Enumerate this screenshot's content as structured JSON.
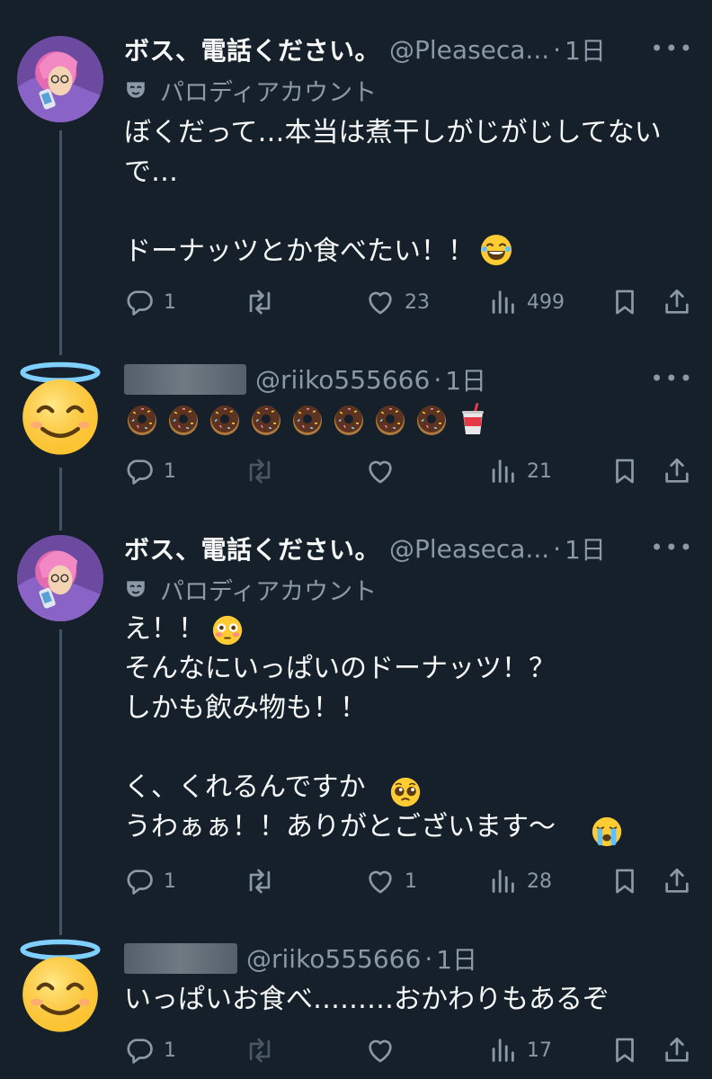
{
  "tweets": [
    {
      "name": "ボス、電話ください。",
      "handle": "@Pleaseca...",
      "time": "1日",
      "parody_label": "パロディアカウント",
      "text": "ぼくだって…本当は煮干しがじがじしてないで…\n\nドーナッツとか食べたい！！",
      "replies": "1",
      "retweets": "",
      "likes": "23",
      "views": "499"
    },
    {
      "name": "",
      "handle": "@riiko555666",
      "time": "1日",
      "text": "",
      "replies": "1",
      "retweets": "",
      "likes": "",
      "views": "21"
    },
    {
      "name": "ボス、電話ください。",
      "handle": "@Pleaseca...",
      "time": "1日",
      "parody_label": "パロディアカウント",
      "text": "え！！\nそんなにいっぱいのドーナッツ！？\nしかも飲み物も！！\n\nく、くれるんですか\nうわぁぁ！！ありがとございます〜",
      "replies": "1",
      "retweets": "",
      "likes": "1",
      "views": "28"
    },
    {
      "name": "",
      "handle": "@riiko555666",
      "time": "1日",
      "text": "いっぱいお食べ………おかわりもあるぞ",
      "replies": "1",
      "retweets": "",
      "likes": "",
      "views": "17"
    }
  ],
  "separator": "·",
  "icons": [
    "reply-icon",
    "retweet-icon",
    "like-icon",
    "views-icon",
    "bookmark-icon",
    "share-icon",
    "more-icon",
    "parody-mask-icon"
  ],
  "colors": {
    "background": "#15202b",
    "text": "#f7f9f9",
    "muted": "#8b98a5",
    "thread_line": "#425364"
  }
}
